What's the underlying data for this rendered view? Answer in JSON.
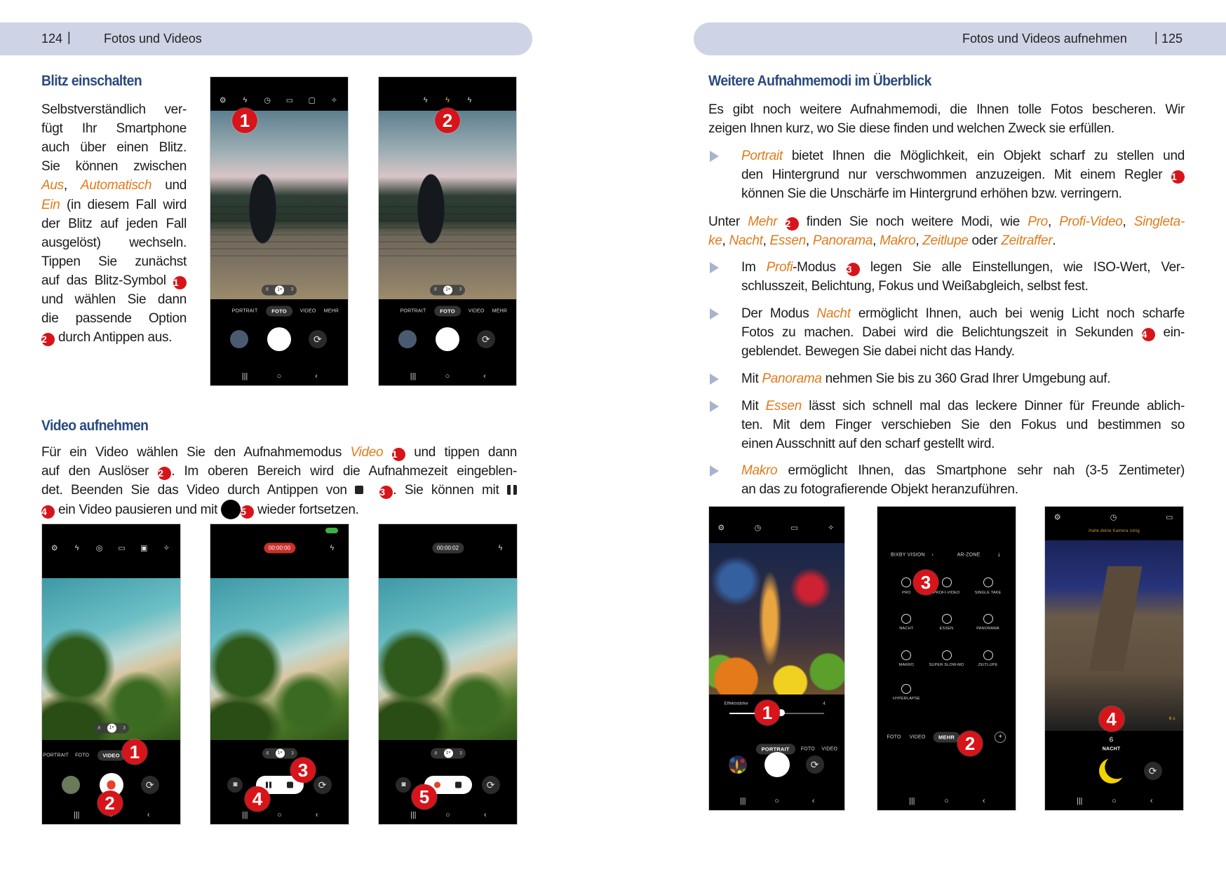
{
  "left_page": {
    "page_number": "124",
    "separator": "|",
    "running_title": "Fotos und Videos",
    "blitz": {
      "heading": "Blitz einschalten",
      "lines": [
        [
          {
            "text": "Selbstverständlich ver-"
          }
        ],
        [
          {
            "text": "fügt Ihr Smartphone"
          }
        ],
        [
          {
            "text": "auch über einen Blitz."
          }
        ],
        [
          {
            "text": "Sie können zwischen"
          }
        ],
        [
          {
            "hl": "Aus"
          },
          {
            "text": ", "
          },
          {
            "hl": "Automatisch"
          },
          {
            "text": " und"
          }
        ],
        [
          {
            "hl": "Ein"
          },
          {
            "text": " (in diesem Fall wird"
          }
        ],
        [
          {
            "text": "der Blitz auf jeden Fall"
          }
        ],
        [
          {
            "text": "ausgelöst) wechseln."
          }
        ],
        [
          {
            "text": "Tippen Sie zunächst"
          }
        ],
        [
          {
            "text": "auf das Blitz-Symbol "
          },
          {
            "badge": "1"
          }
        ],
        [
          {
            "text": "und wählen Sie dann"
          }
        ],
        [
          {
            "text": "die passende Option"
          }
        ],
        [
          {
            "badge": "2"
          },
          {
            "text": " durch Antippen aus."
          }
        ]
      ]
    },
    "video": {
      "heading": "Video aufnehmen",
      "lines": [
        [
          {
            "text": "Für ein Video wählen Sie den Aufnahmemodus "
          },
          {
            "hl": "Video"
          },
          {
            "text": " "
          },
          {
            "badge": "1"
          },
          {
            "text": " und tippen dann"
          }
        ],
        [
          {
            "text": "auf den Auslöser "
          },
          {
            "badge": "2"
          },
          {
            "text": ". Im oberen Bereich wird die Aufnahmezeit eingeblen-"
          }
        ],
        [
          {
            "text": "det. Beenden Sie das Video durch Antippen von "
          },
          {
            "icon": "stop-icon"
          },
          {
            "text": "  "
          },
          {
            "badge": "3"
          },
          {
            "text": ". Sie können mit "
          },
          {
            "icon": "pause-icon"
          }
        ],
        [
          {
            "badge": "4"
          },
          {
            "text": " ein Video pausieren und mit "
          },
          {
            "icon": "record-icon"
          },
          {
            "badge": "5"
          },
          {
            "text": " wieder fortsetzen."
          }
        ]
      ]
    }
  },
  "right_page": {
    "page_number": "125",
    "separator": "|",
    "running_title": "Fotos und Videos aufnehmen",
    "heading": "Weitere Aufnahmemodi im Überblick",
    "blocks": [
      {
        "type": "para",
        "lines": [
          [
            {
              "text": "Es gibt noch weitere Aufnahmemodi, die Ihnen tolle Fotos bescheren. Wir"
            }
          ],
          [
            {
              "text": "zeigen Ihnen kurz, wo Sie diese finden und welchen Zweck sie erfüllen."
            }
          ]
        ]
      },
      {
        "type": "bullet",
        "lines": [
          [
            {
              "hl": "Portrait"
            },
            {
              "text": " bietet Ihnen die Möglichkeit, ein Objekt scharf zu stellen und"
            }
          ],
          [
            {
              "text": "den Hintergrund nur verschwommen anzuzeigen. Mit einem Regler "
            },
            {
              "badge": "1"
            }
          ],
          [
            {
              "text": "können Sie die Unschärfe im Hintergrund erhöhen bzw. verringern."
            }
          ]
        ]
      },
      {
        "type": "para",
        "lines": [
          [
            {
              "text": "Unter "
            },
            {
              "hl": "Mehr"
            },
            {
              "text": " "
            },
            {
              "badge": "2"
            },
            {
              "text": " finden Sie noch weitere Modi, wie "
            },
            {
              "hl": "Pro"
            },
            {
              "text": ", "
            },
            {
              "hl": "Profi-Video"
            },
            {
              "text": ", "
            },
            {
              "hl": "Singleta-"
            }
          ],
          [
            {
              "hl": "ke"
            },
            {
              "text": ", "
            },
            {
              "hl": "Nacht"
            },
            {
              "text": ", "
            },
            {
              "hl": "Essen"
            },
            {
              "text": ", "
            },
            {
              "hl": "Panorama"
            },
            {
              "text": ", "
            },
            {
              "hl": "Makro"
            },
            {
              "text": ", "
            },
            {
              "hl": "Zeitlupe"
            },
            {
              "text": " oder "
            },
            {
              "hl": "Zeitraffer"
            },
            {
              "text": "."
            }
          ]
        ]
      },
      {
        "type": "bullet",
        "lines": [
          [
            {
              "text": "Im "
            },
            {
              "hl": "Profi"
            },
            {
              "text": "-Modus "
            },
            {
              "badge": "3"
            },
            {
              "text": " legen Sie alle Einstellungen, wie ISO-Wert, Ver-"
            }
          ],
          [
            {
              "text": "schlusszeit, Belichtung, Fokus und Weißabgleich, selbst fest."
            }
          ]
        ]
      },
      {
        "type": "bullet",
        "lines": [
          [
            {
              "text": "Der Modus "
            },
            {
              "hl": "Nacht"
            },
            {
              "text": " ermöglicht Ihnen, auch bei wenig Licht noch scharfe"
            }
          ],
          [
            {
              "text": "Fotos zu machen. Dabei wird die Belichtungszeit in Sekunden "
            },
            {
              "badge": "4"
            },
            {
              "text": " ein-"
            }
          ],
          [
            {
              "text": "geblendet. Bewegen Sie dabei nicht das Handy."
            }
          ]
        ]
      },
      {
        "type": "bullet",
        "lines": [
          [
            {
              "text": "Mit "
            },
            {
              "hl": "Panorama"
            },
            {
              "text": " nehmen Sie bis zu 360 Grad Ihrer Umgebung auf."
            }
          ]
        ]
      },
      {
        "type": "bullet",
        "lines": [
          [
            {
              "text": "Mit "
            },
            {
              "hl": "Essen"
            },
            {
              "text": " lässt sich schnell mal das leckere Dinner für Freunde ablich-"
            }
          ],
          [
            {
              "text": "ten. Mit dem Finger verschieben Sie den Fokus und bestimmen so"
            }
          ],
          [
            {
              "text": "einen Ausschnitt auf den scharf gestellt wird."
            }
          ]
        ]
      },
      {
        "type": "bullet",
        "lines": [
          [
            {
              "hl": "Makro"
            },
            {
              "text": " ermöglicht Ihnen, das Smartphone sehr nah (3-5 Zentimeter)"
            }
          ],
          [
            {
              "text": "an das zu fotografierende Objekt heranzuführen."
            }
          ]
        ]
      }
    ]
  },
  "phones": {
    "modes": [
      "PORTRAIT",
      "FOTO",
      "VIDEO",
      "MEHR"
    ],
    "zoom": [
      ".6",
      "1×",
      "3"
    ],
    "flash_1": {
      "icons": [
        "gear-icon",
        "flash-auto-icon",
        "timer-icon",
        "ratio-icon",
        "motion-photo-icon",
        "effects-icon"
      ],
      "active_mode": "FOTO",
      "badge": "1"
    },
    "flash_2": {
      "icons": [
        "flash-off-icon",
        "flash-auto-icon",
        "flash-on-icon"
      ],
      "active_mode": "FOTO",
      "badge": "2"
    },
    "video_1": {
      "icons": [
        "gear-icon",
        "flash-icon",
        "stabilizer-icon",
        "ratio-icon",
        "uhd-icon",
        "effects-icon"
      ],
      "modes": [
        "PORTRAIT",
        "FOTO",
        "VIDEO"
      ],
      "active_mode": "VIDEO",
      "badges": [
        "1",
        "2"
      ]
    },
    "video_2": {
      "timer": "00:00:00",
      "badges": [
        "3",
        "4"
      ]
    },
    "video_3": {
      "timer": "00:00:02",
      "badges": [
        "5"
      ]
    },
    "portrait": {
      "icons": [
        "gear-icon",
        "timer-icon",
        "ratio-icon",
        "effects-icon"
      ],
      "slider_label": "Effektstärke",
      "slider_value": "4",
      "slider_level": 0.55,
      "modes": [
        "PORTRAIT",
        "FOTO",
        "VIDEO"
      ],
      "active_mode": "PORTRAIT",
      "badge": "1"
    },
    "more": {
      "top": [
        "BIXBY VISION",
        "AR-ZONE"
      ],
      "modes": [
        "PRO",
        "PROFI-VIDEO",
        "SINGLE TAKE",
        "NACHT",
        "ESSEN",
        "PANORAMA",
        "MAKRO",
        "SUPER SLOW-MO",
        "ZEITLUPE",
        "HYPERLAPSE"
      ],
      "bottom": [
        "FOTO",
        "VIDEO",
        "MEHR"
      ],
      "active": "MEHR",
      "badges": [
        "3",
        "2"
      ]
    },
    "night": {
      "icons": [
        "gear-icon",
        "timer-icon",
        "ratio-icon"
      ],
      "hint": "Halte deine Kamera ruhig",
      "exposure_badge": "6 s",
      "countdown": "6",
      "mode_label": "NACHT",
      "badge": "4"
    }
  },
  "colors": {
    "band": "#cfd3e6",
    "heading": "#2a4a7f",
    "highlight": "#e07b1a",
    "badge": "#d7141a"
  }
}
